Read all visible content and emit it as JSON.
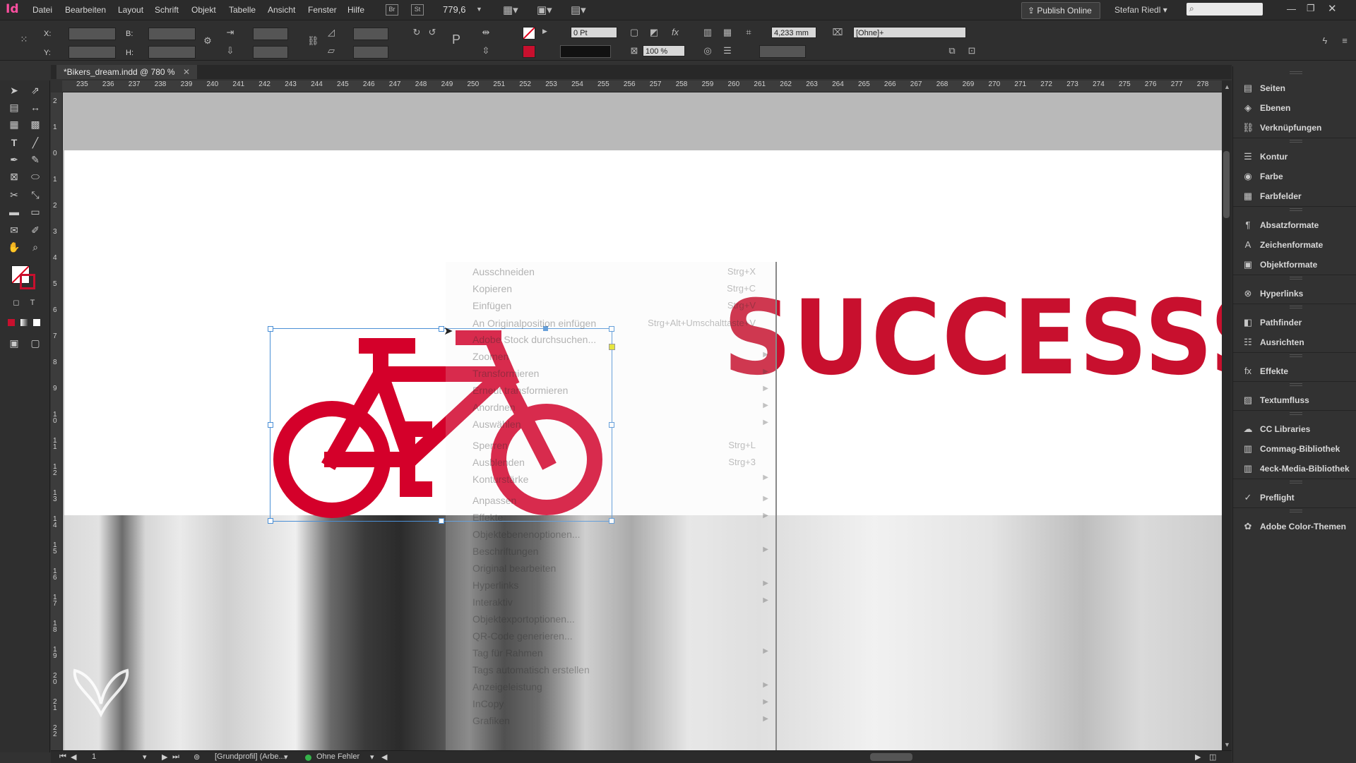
{
  "app": {
    "logo": "Id"
  },
  "menu": [
    "Datei",
    "Bearbeiten",
    "Layout",
    "Schrift",
    "Objekt",
    "Tabelle",
    "Ansicht",
    "Fenster",
    "Hilfe"
  ],
  "appbar": {
    "bridge": "Br",
    "stock": "St",
    "zoom": "779,6",
    "publish": "Publish Online",
    "user": "Stefan Riedl"
  },
  "control": {
    "x_label": "X:",
    "y_label": "Y:",
    "w_label": "B:",
    "h_label": "H:",
    "stroke_weight": "0 Pt",
    "opacity": "100 %",
    "corner": "4,233 mm",
    "object_style": "[Ohne]+"
  },
  "document": {
    "tab": "*Bikers_dream.indd @ 780 %"
  },
  "ruler_h": [
    "235",
    "236",
    "237",
    "238",
    "239",
    "240",
    "241",
    "242",
    "243",
    "244",
    "245",
    "246",
    "247",
    "248",
    "249",
    "250",
    "251",
    "252",
    "253",
    "254",
    "255",
    "256",
    "257",
    "258",
    "259",
    "260",
    "261",
    "262",
    "263",
    "264",
    "265",
    "266",
    "267",
    "268",
    "269",
    "270",
    "271",
    "272",
    "273",
    "274",
    "275",
    "276",
    "277",
    "278"
  ],
  "ruler_v": [
    "2",
    "1",
    "0",
    "1",
    "2",
    "3",
    "4",
    "5",
    "6",
    "7",
    "8",
    "9",
    "1 0",
    "1 1",
    "1 2",
    "1 3",
    "1 4",
    "1 5",
    "1 6",
    "1 7",
    "1 8",
    "1 9",
    "2 0",
    "2 1",
    "2 2"
  ],
  "canvas": {
    "headline": "SUCCESSS",
    "accent": "#c8102e"
  },
  "context_menu": [
    {
      "label": "Ausschneiden",
      "shortcut": "Strg+X"
    },
    {
      "label": "Kopieren",
      "shortcut": "Strg+C"
    },
    {
      "label": "Einfügen",
      "shortcut": "Strg+V"
    },
    {
      "label": "An Originalposition einfügen",
      "shortcut": "Strg+Alt+Umschalttaste+V"
    },
    {
      "label": "Adobe Stock durchsuchen...",
      "shortcut": ""
    },
    {
      "label": "Zoomen",
      "shortcut": "",
      "sub": true
    },
    {
      "label": "Transformieren",
      "shortcut": "",
      "sub": true
    },
    {
      "label": "Erneut transformieren",
      "shortcut": "",
      "sub": true
    },
    {
      "label": "Anordnen",
      "shortcut": "",
      "sub": true
    },
    {
      "label": "Auswählen",
      "shortcut": "",
      "sub": true
    },
    {
      "label": "Sperren",
      "shortcut": "Strg+L"
    },
    {
      "label": "Ausblenden",
      "shortcut": "Strg+3"
    },
    {
      "label": "Konturstärke",
      "shortcut": "",
      "sub": true
    },
    {
      "label": "Anpassen",
      "shortcut": "",
      "sub": true
    },
    {
      "label": "Effekte",
      "shortcut": "",
      "sub": true
    },
    {
      "label": "Objektebenenoptionen...",
      "shortcut": ""
    },
    {
      "label": "Beschriftungen",
      "shortcut": "",
      "sub": true
    },
    {
      "label": "Original bearbeiten",
      "shortcut": ""
    },
    {
      "label": "Hyperlinks",
      "shortcut": "",
      "sub": true
    },
    {
      "label": "Interaktiv",
      "shortcut": "",
      "sub": true
    },
    {
      "label": "Objektexportoptionen...",
      "shortcut": ""
    },
    {
      "label": "QR-Code generieren...",
      "shortcut": ""
    },
    {
      "label": "Tag für Rahmen",
      "shortcut": "",
      "sub": true
    },
    {
      "label": "Tags automatisch erstellen",
      "shortcut": ""
    },
    {
      "label": "Anzeigeleistung",
      "shortcut": "",
      "sub": true
    },
    {
      "label": "InCopy",
      "shortcut": "",
      "sub": true
    },
    {
      "label": "Grafiken",
      "shortcut": "",
      "sub": true
    }
  ],
  "panels": [
    {
      "label": "Seiten",
      "icon": "pages-icon",
      "glyph": "▤"
    },
    {
      "label": "Ebenen",
      "icon": "layers-icon",
      "glyph": "◈"
    },
    {
      "label": "Verknüpfungen",
      "icon": "links-icon",
      "glyph": "⛓"
    },
    {
      "label": "Kontur",
      "icon": "stroke-icon",
      "glyph": "☰"
    },
    {
      "label": "Farbe",
      "icon": "color-icon",
      "glyph": "◉"
    },
    {
      "label": "Farbfelder",
      "icon": "swatches-icon",
      "glyph": "▦"
    },
    {
      "label": "Absatzformate",
      "icon": "paragraph-styles-icon",
      "glyph": "¶"
    },
    {
      "label": "Zeichenformate",
      "icon": "character-styles-icon",
      "glyph": "A"
    },
    {
      "label": "Objektformate",
      "icon": "object-styles-icon",
      "glyph": "▣"
    },
    {
      "label": "Hyperlinks",
      "icon": "hyperlinks-icon",
      "glyph": "⊗"
    },
    {
      "label": "Pathfinder",
      "icon": "pathfinder-icon",
      "glyph": "◧"
    },
    {
      "label": "Ausrichten",
      "icon": "align-icon",
      "glyph": "☷"
    },
    {
      "label": "Effekte",
      "icon": "effects-icon",
      "glyph": "fx"
    },
    {
      "label": "Textumfluss",
      "icon": "text-wrap-icon",
      "glyph": "▨"
    },
    {
      "label": "CC Libraries",
      "icon": "cc-libraries-icon",
      "glyph": "☁"
    },
    {
      "label": "Commag-Bibliothek",
      "icon": "library-icon",
      "glyph": "▥"
    },
    {
      "label": "4eck-Media-Bibliothek",
      "icon": "library-icon",
      "glyph": "▥"
    },
    {
      "label": "Preflight",
      "icon": "preflight-icon",
      "glyph": "✓"
    },
    {
      "label": "Adobe Color-Themen",
      "icon": "color-themes-icon",
      "glyph": "✿"
    }
  ],
  "status": {
    "page": "1",
    "profile": "[Grundprofil] (Arbe...",
    "errors": "Ohne Fehler"
  }
}
